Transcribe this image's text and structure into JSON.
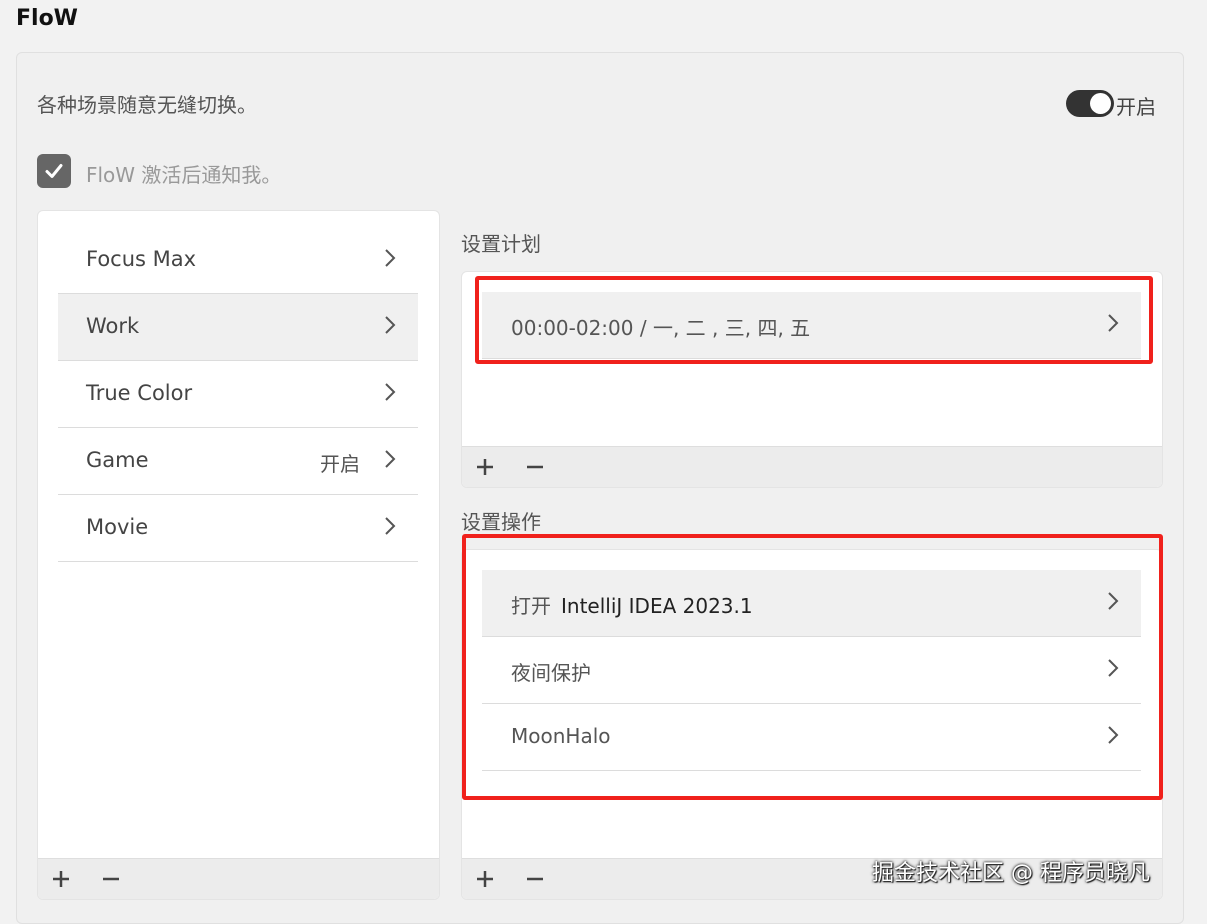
{
  "app": {
    "title": "FloW"
  },
  "header": {
    "description": "各种场景随意无缝切换。",
    "toggle_label": "开启",
    "notify_label": "FloW 激活后通知我。"
  },
  "scenes": [
    {
      "label": "Focus Max",
      "status": ""
    },
    {
      "label": "Work",
      "status": ""
    },
    {
      "label": "True Color",
      "status": ""
    },
    {
      "label": "Game",
      "status": "开启"
    },
    {
      "label": "Movie",
      "status": ""
    }
  ],
  "schedule": {
    "title": "设置计划",
    "items": [
      {
        "text": "00:00-02:00  / 一, 二 , 三, 四, 五"
      }
    ]
  },
  "actions": {
    "title": "设置操作",
    "items": [
      {
        "prefix": "打开",
        "name": "IntelliJ IDEA 2023.1"
      },
      {
        "prefix": "夜间保护",
        "name": ""
      },
      {
        "prefix": "MoonHalo",
        "name": ""
      }
    ]
  },
  "controls": {
    "add": "+",
    "remove": "−"
  },
  "watermark": "掘金技术社区 @ 程序员晓凡",
  "colors": {
    "highlight": "#f0211c",
    "toggle_on": "#333333"
  },
  "icons": [
    "check-icon",
    "chevron-right-icon",
    "plus-icon",
    "minus-icon"
  ]
}
